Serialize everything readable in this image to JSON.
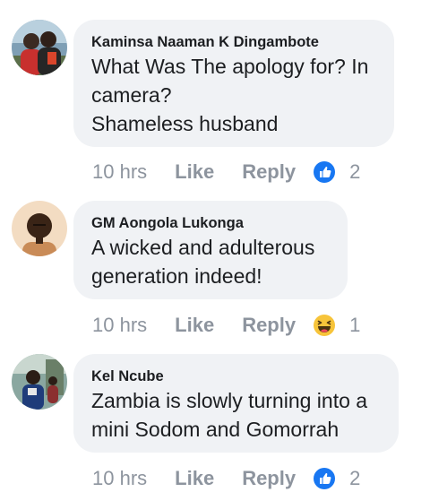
{
  "colors": {
    "bubble_bg": "#f0f2f5",
    "meta_text": "#8d949e",
    "like_blue": "#1877f2",
    "haha_yellow": "#f7c43a"
  },
  "comments": [
    {
      "author": "Kaminsa Naaman K Dingambote",
      "text": "What Was The apology for? In\ncamera?\nShameless husband",
      "time": "10 hrs",
      "like_label": "Like",
      "reply_label": "Reply",
      "reaction_icon": "like-reaction-icon",
      "reaction_count": "2"
    },
    {
      "author": "GM Aongola Lukonga",
      "text": "A wicked and adulterous\ngeneration indeed!",
      "time": "10 hrs",
      "like_label": "Like",
      "reply_label": "Reply",
      "reaction_icon": "haha-reaction-icon",
      "reaction_count": "1"
    },
    {
      "author": "Kel Ncube",
      "text": "Zambia is slowly turning into a\nmini Sodom and Gomorrah",
      "time": "10 hrs",
      "like_label": "Like",
      "reply_label": "Reply",
      "reaction_icon": "like-reaction-icon",
      "reaction_count": "2"
    }
  ]
}
